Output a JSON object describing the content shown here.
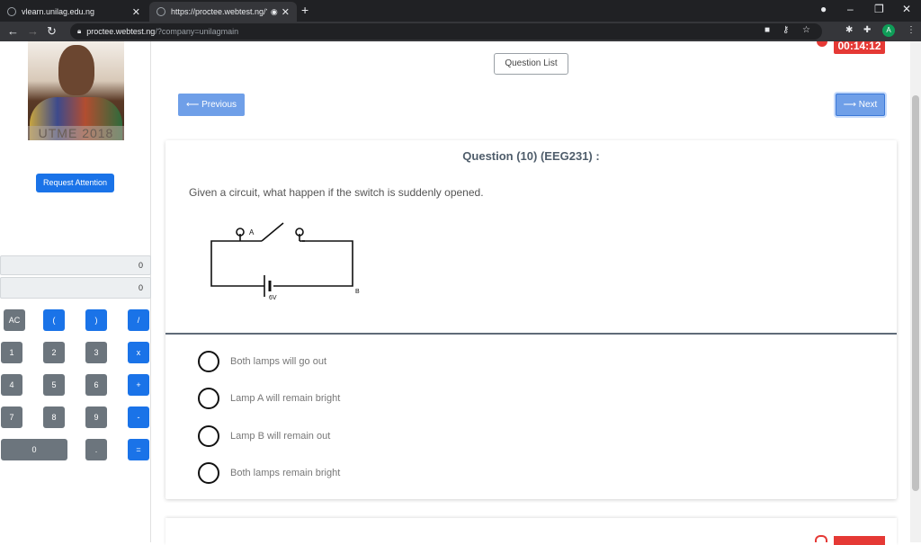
{
  "browser": {
    "tabs": [
      {
        "label": "vlearn.unilag.edu.ng",
        "close": "✕"
      },
      {
        "label": "https://proctee.webtest.ng/?",
        "close": "✕"
      }
    ],
    "new_tab": "+",
    "url_host": "proctee.webtest.ng",
    "url_path": "/?company=unilagmain",
    "profile_initial": "A"
  },
  "left": {
    "photo_watermark": "UTME 2018",
    "request_attention": "Request Attention",
    "calculator": {
      "display_top": "0",
      "display_bottom": "0",
      "keys": [
        "AC",
        "(",
        ")",
        "/",
        "1",
        "2",
        "3",
        "x",
        "4",
        "5",
        "6",
        "+",
        "7",
        "8",
        "9",
        "-",
        "0",
        ".",
        "="
      ]
    }
  },
  "main": {
    "timer": "00:14:12",
    "question_list": "Question List",
    "previous": "⟵ Previous",
    "next": "⟶ Next",
    "question_title": "Question (10) (EEG231) :",
    "question_text": "Given a circuit, what happen if the switch is suddenly opened.",
    "circuit_labels": {
      "lamp_a": "A",
      "lamp_b": "B",
      "battery": "6V"
    },
    "options": [
      "Both lamps will go out",
      "Lamp A will remain bright",
      "Lamp B will remain out",
      "Both lamps remain bright"
    ]
  },
  "colors": {
    "accent": "#1a73e8",
    "nav_button": "#6f9fe8",
    "timer": "#e53935"
  }
}
